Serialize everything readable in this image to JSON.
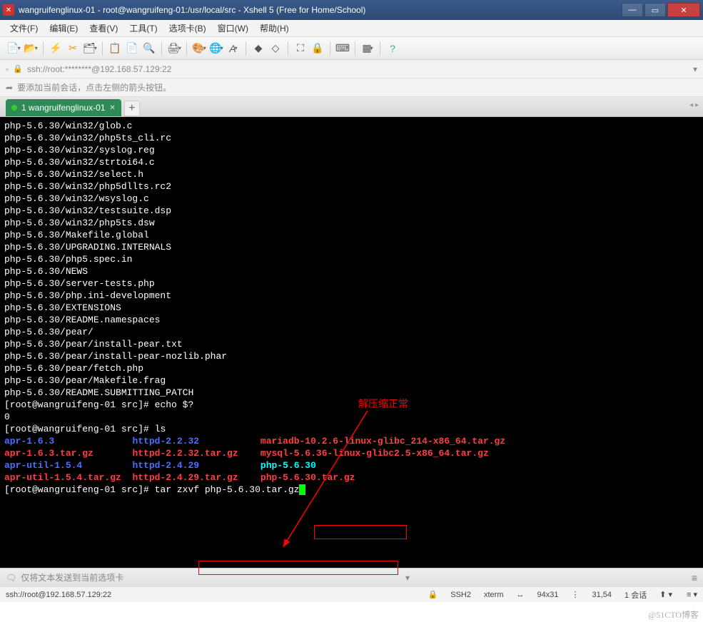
{
  "window": {
    "title": "wangruifenglinux-01 - root@wangruifeng-01:/usr/local/src - Xshell 5 (Free for Home/School)"
  },
  "menu": {
    "file": "文件(F)",
    "edit": "编辑(E)",
    "view": "查看(V)",
    "tools": "工具(T)",
    "tab": "选项卡(B)",
    "window": "窗口(W)",
    "help": "帮助(H)"
  },
  "address": {
    "text": "ssh://root:********@192.168.57.129:22"
  },
  "hint": {
    "text": "要添加当前会话，点击左侧的箭头按钮。"
  },
  "tabs": {
    "active": "1 wangruifenglinux-01"
  },
  "terminal": {
    "lines": [
      {
        "t": "php-5.6.30/win32/glob.c",
        "c": "w"
      },
      {
        "t": "php-5.6.30/win32/php5ts_cli.rc",
        "c": "w"
      },
      {
        "t": "php-5.6.30/win32/syslog.reg",
        "c": "w"
      },
      {
        "t": "php-5.6.30/win32/strtoi64.c",
        "c": "w"
      },
      {
        "t": "php-5.6.30/win32/select.h",
        "c": "w"
      },
      {
        "t": "php-5.6.30/win32/php5dllts.rc2",
        "c": "w"
      },
      {
        "t": "php-5.6.30/win32/wsyslog.c",
        "c": "w"
      },
      {
        "t": "php-5.6.30/win32/testsuite.dsp",
        "c": "w"
      },
      {
        "t": "php-5.6.30/win32/php5ts.dsw",
        "c": "w"
      },
      {
        "t": "php-5.6.30/Makefile.global",
        "c": "w"
      },
      {
        "t": "php-5.6.30/UPGRADING.INTERNALS",
        "c": "w"
      },
      {
        "t": "php-5.6.30/php5.spec.in",
        "c": "w"
      },
      {
        "t": "php-5.6.30/NEWS",
        "c": "w"
      },
      {
        "t": "php-5.6.30/server-tests.php",
        "c": "w"
      },
      {
        "t": "php-5.6.30/php.ini-development",
        "c": "w"
      },
      {
        "t": "php-5.6.30/EXTENSIONS",
        "c": "w"
      },
      {
        "t": "php-5.6.30/README.namespaces",
        "c": "w"
      },
      {
        "t": "php-5.6.30/pear/",
        "c": "w"
      },
      {
        "t": "php-5.6.30/pear/install-pear.txt",
        "c": "w"
      },
      {
        "t": "php-5.6.30/pear/install-pear-nozlib.phar",
        "c": "w"
      },
      {
        "t": "php-5.6.30/pear/fetch.php",
        "c": "w"
      },
      {
        "t": "php-5.6.30/pear/Makefile.frag",
        "c": "w"
      },
      {
        "t": "php-5.6.30/README.SUBMITTING_PATCH",
        "c": "w"
      }
    ],
    "prompt1_pre": "[root@wangruifeng-01 src]# ",
    "prompt1_cmd": "echo $?",
    "echo_out": "0",
    "prompt2_pre": "[root@wangruifeng-01 src]# ",
    "prompt2_cmd": "ls",
    "ls_cols": [
      [
        "apr-1.6.3",
        "apr-1.6.3.tar.gz",
        "apr-util-1.5.4",
        "apr-util-1.5.4.tar.gz"
      ],
      [
        "httpd-2.2.32",
        "httpd-2.2.32.tar.gz",
        "httpd-2.4.29",
        "httpd-2.4.29.tar.gz"
      ],
      [
        "mariadb-10.2.6-linux-glibc_214-x86_64.tar.gz",
        "mysql-5.6.36-linux-glibc2.5-x86_64.tar.gz",
        "php-5.6.30",
        "php-5.6.30.tar.gz"
      ]
    ],
    "ls_colors": [
      [
        "dblue",
        "red",
        "dblue",
        "red"
      ],
      [
        "dblue",
        "red",
        "dblue",
        "red"
      ],
      [
        "red",
        "red",
        "bcyan",
        "red"
      ]
    ],
    "prompt3_pre": "[root@wangruifeng-01 src]# ",
    "prompt3_cmd": "tar zxvf php-5.6.30.tar.gz"
  },
  "annotation": {
    "label": "解压缩正常"
  },
  "sendbar": {
    "text": "仅将文本发送到当前选项卡"
  },
  "status": {
    "conn": "ssh://root@192.168.57.129:22",
    "ssh": "SSH2",
    "term": "xterm",
    "size": "94x31",
    "pos": "31,54",
    "sessions": "1 会话"
  },
  "watermark": "@51CTO博客"
}
